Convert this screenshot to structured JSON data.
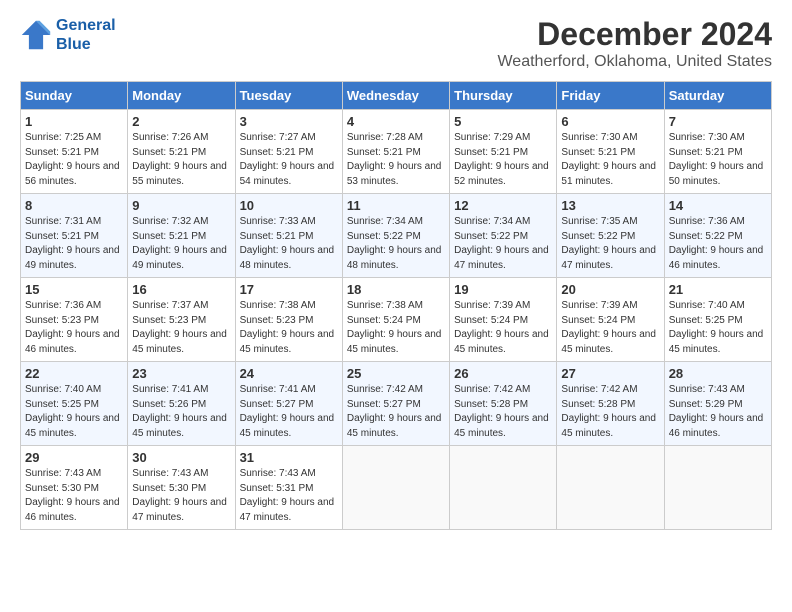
{
  "logo": {
    "line1": "General",
    "line2": "Blue"
  },
  "title": "December 2024",
  "subtitle": "Weatherford, Oklahoma, United States",
  "days_header": [
    "Sunday",
    "Monday",
    "Tuesday",
    "Wednesday",
    "Thursday",
    "Friday",
    "Saturday"
  ],
  "weeks": [
    [
      {
        "day": "1",
        "sunrise": "Sunrise: 7:25 AM",
        "sunset": "Sunset: 5:21 PM",
        "daylight": "Daylight: 9 hours and 56 minutes."
      },
      {
        "day": "2",
        "sunrise": "Sunrise: 7:26 AM",
        "sunset": "Sunset: 5:21 PM",
        "daylight": "Daylight: 9 hours and 55 minutes."
      },
      {
        "day": "3",
        "sunrise": "Sunrise: 7:27 AM",
        "sunset": "Sunset: 5:21 PM",
        "daylight": "Daylight: 9 hours and 54 minutes."
      },
      {
        "day": "4",
        "sunrise": "Sunrise: 7:28 AM",
        "sunset": "Sunset: 5:21 PM",
        "daylight": "Daylight: 9 hours and 53 minutes."
      },
      {
        "day": "5",
        "sunrise": "Sunrise: 7:29 AM",
        "sunset": "Sunset: 5:21 PM",
        "daylight": "Daylight: 9 hours and 52 minutes."
      },
      {
        "day": "6",
        "sunrise": "Sunrise: 7:30 AM",
        "sunset": "Sunset: 5:21 PM",
        "daylight": "Daylight: 9 hours and 51 minutes."
      },
      {
        "day": "7",
        "sunrise": "Sunrise: 7:30 AM",
        "sunset": "Sunset: 5:21 PM",
        "daylight": "Daylight: 9 hours and 50 minutes."
      }
    ],
    [
      {
        "day": "8",
        "sunrise": "Sunrise: 7:31 AM",
        "sunset": "Sunset: 5:21 PM",
        "daylight": "Daylight: 9 hours and 49 minutes."
      },
      {
        "day": "9",
        "sunrise": "Sunrise: 7:32 AM",
        "sunset": "Sunset: 5:21 PM",
        "daylight": "Daylight: 9 hours and 49 minutes."
      },
      {
        "day": "10",
        "sunrise": "Sunrise: 7:33 AM",
        "sunset": "Sunset: 5:21 PM",
        "daylight": "Daylight: 9 hours and 48 minutes."
      },
      {
        "day": "11",
        "sunrise": "Sunrise: 7:34 AM",
        "sunset": "Sunset: 5:22 PM",
        "daylight": "Daylight: 9 hours and 48 minutes."
      },
      {
        "day": "12",
        "sunrise": "Sunrise: 7:34 AM",
        "sunset": "Sunset: 5:22 PM",
        "daylight": "Daylight: 9 hours and 47 minutes."
      },
      {
        "day": "13",
        "sunrise": "Sunrise: 7:35 AM",
        "sunset": "Sunset: 5:22 PM",
        "daylight": "Daylight: 9 hours and 47 minutes."
      },
      {
        "day": "14",
        "sunrise": "Sunrise: 7:36 AM",
        "sunset": "Sunset: 5:22 PM",
        "daylight": "Daylight: 9 hours and 46 minutes."
      }
    ],
    [
      {
        "day": "15",
        "sunrise": "Sunrise: 7:36 AM",
        "sunset": "Sunset: 5:23 PM",
        "daylight": "Daylight: 9 hours and 46 minutes."
      },
      {
        "day": "16",
        "sunrise": "Sunrise: 7:37 AM",
        "sunset": "Sunset: 5:23 PM",
        "daylight": "Daylight: 9 hours and 45 minutes."
      },
      {
        "day": "17",
        "sunrise": "Sunrise: 7:38 AM",
        "sunset": "Sunset: 5:23 PM",
        "daylight": "Daylight: 9 hours and 45 minutes."
      },
      {
        "day": "18",
        "sunrise": "Sunrise: 7:38 AM",
        "sunset": "Sunset: 5:24 PM",
        "daylight": "Daylight: 9 hours and 45 minutes."
      },
      {
        "day": "19",
        "sunrise": "Sunrise: 7:39 AM",
        "sunset": "Sunset: 5:24 PM",
        "daylight": "Daylight: 9 hours and 45 minutes."
      },
      {
        "day": "20",
        "sunrise": "Sunrise: 7:39 AM",
        "sunset": "Sunset: 5:24 PM",
        "daylight": "Daylight: 9 hours and 45 minutes."
      },
      {
        "day": "21",
        "sunrise": "Sunrise: 7:40 AM",
        "sunset": "Sunset: 5:25 PM",
        "daylight": "Daylight: 9 hours and 45 minutes."
      }
    ],
    [
      {
        "day": "22",
        "sunrise": "Sunrise: 7:40 AM",
        "sunset": "Sunset: 5:25 PM",
        "daylight": "Daylight: 9 hours and 45 minutes."
      },
      {
        "day": "23",
        "sunrise": "Sunrise: 7:41 AM",
        "sunset": "Sunset: 5:26 PM",
        "daylight": "Daylight: 9 hours and 45 minutes."
      },
      {
        "day": "24",
        "sunrise": "Sunrise: 7:41 AM",
        "sunset": "Sunset: 5:27 PM",
        "daylight": "Daylight: 9 hours and 45 minutes."
      },
      {
        "day": "25",
        "sunrise": "Sunrise: 7:42 AM",
        "sunset": "Sunset: 5:27 PM",
        "daylight": "Daylight: 9 hours and 45 minutes."
      },
      {
        "day": "26",
        "sunrise": "Sunrise: 7:42 AM",
        "sunset": "Sunset: 5:28 PM",
        "daylight": "Daylight: 9 hours and 45 minutes."
      },
      {
        "day": "27",
        "sunrise": "Sunrise: 7:42 AM",
        "sunset": "Sunset: 5:28 PM",
        "daylight": "Daylight: 9 hours and 45 minutes."
      },
      {
        "day": "28",
        "sunrise": "Sunrise: 7:43 AM",
        "sunset": "Sunset: 5:29 PM",
        "daylight": "Daylight: 9 hours and 46 minutes."
      }
    ],
    [
      {
        "day": "29",
        "sunrise": "Sunrise: 7:43 AM",
        "sunset": "Sunset: 5:30 PM",
        "daylight": "Daylight: 9 hours and 46 minutes."
      },
      {
        "day": "30",
        "sunrise": "Sunrise: 7:43 AM",
        "sunset": "Sunset: 5:30 PM",
        "daylight": "Daylight: 9 hours and 47 minutes."
      },
      {
        "day": "31",
        "sunrise": "Sunrise: 7:43 AM",
        "sunset": "Sunset: 5:31 PM",
        "daylight": "Daylight: 9 hours and 47 minutes."
      },
      null,
      null,
      null,
      null
    ]
  ]
}
